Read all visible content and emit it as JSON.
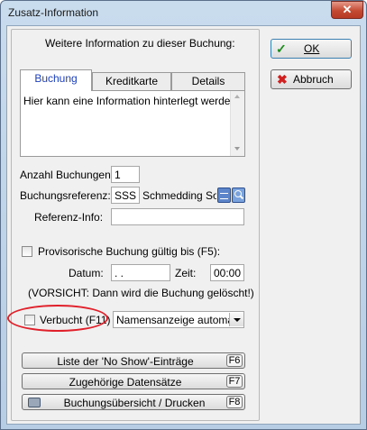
{
  "window": {
    "title": "Zusatz-Information",
    "close_glyph": "✕"
  },
  "header_text": "Weitere Information zu dieser Buchung:",
  "tabs": [
    {
      "label": "Buchung"
    },
    {
      "label": "Kreditkarte"
    },
    {
      "label": "Details"
    }
  ],
  "memo_text": "Hier kann eine Information hinterlegt werden",
  "anzahl": {
    "label": "Anzahl Buchungen:",
    "value": "1"
  },
  "referenz": {
    "label": "Buchungsreferenz:",
    "value": "SSS",
    "company": "Schmedding Soft"
  },
  "referenz_info": {
    "label": "Referenz-Info:",
    "value": ""
  },
  "provisorisch": {
    "label": "Provisorische Buchung gültig bis (F5):",
    "checked": false
  },
  "datum": {
    "label": "Datum:",
    "value": " .  ."
  },
  "zeit": {
    "label": "Zeit:",
    "value": "00:00"
  },
  "warning": "(VORSICHT: Dann wird die Buchung gelöscht!)",
  "verbucht": {
    "label": "Verbucht (F11)",
    "checked": false
  },
  "namensanzeige": {
    "value": "Namensanzeige automatis"
  },
  "bottom_buttons": [
    {
      "label": "Liste der 'No Show'-Einträge",
      "key": "F6"
    },
    {
      "label": "Zugehörige Datensätze",
      "key": "F7"
    },
    {
      "label": "Buchungsübersicht / Drucken",
      "key": "F8"
    }
  ],
  "ok_button": {
    "label": "OK"
  },
  "abbruch_button": {
    "label": "Abbruch"
  },
  "colors": {
    "highlight_ellipse": "#e0202a",
    "tab_active_text": "#1c3fbf"
  }
}
